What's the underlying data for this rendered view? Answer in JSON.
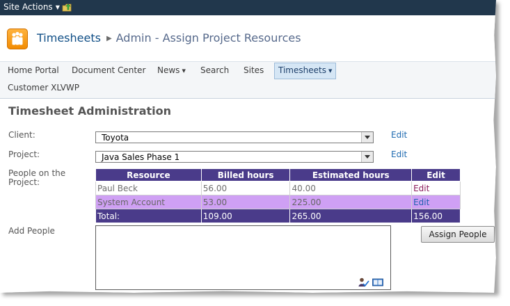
{
  "ribbon": {
    "site_actions": "Site Actions"
  },
  "header": {
    "site_title": "Timesheets",
    "page_title": "Admin - Assign Project Resources"
  },
  "nav": {
    "items": [
      {
        "label": "Home Portal"
      },
      {
        "label": "Document Center"
      },
      {
        "label": "News"
      },
      {
        "label": "Search"
      },
      {
        "label": "Sites"
      },
      {
        "label": "Timesheets"
      },
      {
        "label": "Customer XLVWP"
      }
    ]
  },
  "main": {
    "heading": "Timesheet Administration",
    "client": {
      "label": "Client:",
      "value": "Toyota",
      "edit": "Edit"
    },
    "project": {
      "label": "Project:",
      "value": "Java Sales Phase 1",
      "edit": "Edit"
    },
    "people_label": "People on the Project:",
    "table": {
      "headers": [
        "Resource",
        "Billed hours",
        "Estimated hours",
        "Edit"
      ],
      "rows": [
        {
          "resource": "Paul Beck",
          "billed": "56.00",
          "estimated": "40.00",
          "edit": "Edit"
        },
        {
          "resource": "System Account",
          "billed": "53.00",
          "estimated": "225.00",
          "edit": "Edit"
        }
      ],
      "total": {
        "label": "Total:",
        "billed": "109.00",
        "estimated": "265.00",
        "edit_col": "156.00"
      }
    },
    "add_people_label": "Add People",
    "assign_button": "Assign People"
  },
  "colors": {
    "ribbon": "#21374c",
    "table_header": "#4a3b8a",
    "alt_row": "#cfa0f4",
    "link": "#1e6ab0"
  }
}
